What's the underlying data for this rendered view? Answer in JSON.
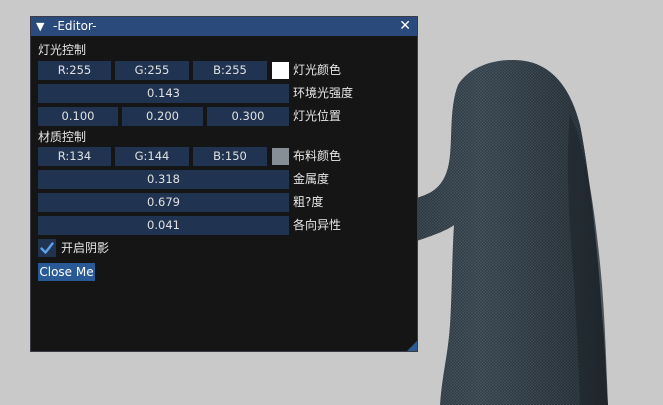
{
  "window": {
    "collapse_glyph": "▼",
    "title": "-Editor-",
    "close_glyph": "✕"
  },
  "light": {
    "section_title": "灯光控制",
    "color": {
      "r": "R:255",
      "g": "G:255",
      "b": "B:255",
      "swatch": "#ffffff",
      "label": "灯光颜色"
    },
    "ambient": {
      "value": "0.143",
      "label": "环境光强度"
    },
    "position": {
      "x": "0.100",
      "y": "0.200",
      "z": "0.300",
      "label": "灯光位置"
    }
  },
  "material": {
    "section_title": "材质控制",
    "color": {
      "r": "R:134",
      "g": "G:144",
      "b": "B:150",
      "swatch": "#868f96",
      "label": "布料颜色"
    },
    "metallic": {
      "value": "0.318",
      "label": "金属度"
    },
    "roughness": {
      "value": "0.679",
      "label": "粗?度"
    },
    "anisotropy": {
      "value": "0.041",
      "label": "各向异性"
    }
  },
  "shadows": {
    "checked": true,
    "label": "开启阴影"
  },
  "close_button": {
    "label": "Close Me"
  },
  "colors": {
    "title_bar": "#294a7a",
    "field_bg": "#203452",
    "button_bg": "#2a5a95",
    "check_mark": "#5fa0e8",
    "viewport_bg": "#c9c9c9",
    "cloth": "#3a4650"
  }
}
